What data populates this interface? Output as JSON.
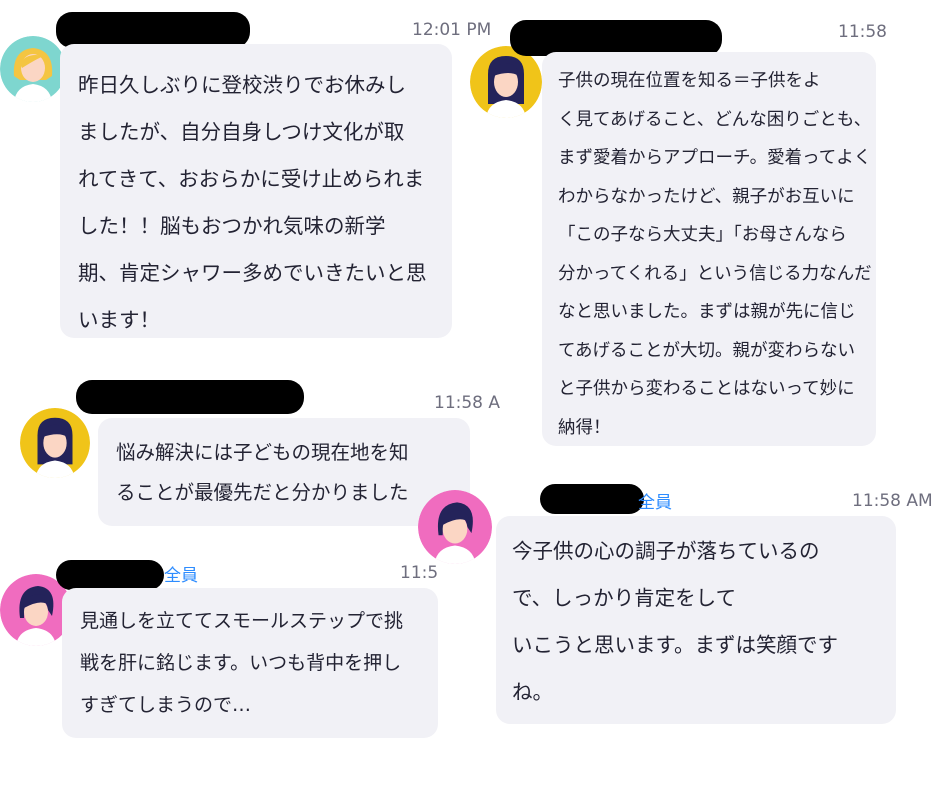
{
  "messages": [
    {
      "id": "m1",
      "time": "12:01 PM",
      "avatar": "blonde-woman-avatar",
      "avatar_bg": "#7ed6cf",
      "lines": [
        "昨日久しぶりに登校渋りでお休みし",
        "ましたが、自分自身しつけ文化が取",
        "れてきて、おおらかに受け止められま",
        "した！！脳もおつかれ気味の新学",
        "期、肯定シャワー多めでいきたいと思",
        "います！"
      ]
    },
    {
      "id": "m2",
      "time": "11:58",
      "avatar": "dark-hair-woman-avatar",
      "avatar_bg": "#f0c419",
      "lines": [
        "子供の現在位置を知る＝子供をよ",
        "く見てあげること、どんな困りごとも、",
        "まず愛着からアプローチ。愛着ってよく",
        "わからなかったけど、親子がお互いに",
        "「この子なら大丈夫」「お母さんなら",
        "分かってくれる」という信じる力なんだ",
        "なと思いました。まずは親が先に信じ",
        "てあげることが大切。親が変わらない",
        "と子供から変わることはないって妙に",
        "納得！"
      ]
    },
    {
      "id": "m3",
      "time": "11:58 A",
      "avatar": "dark-hair-woman-avatar",
      "avatar_bg": "#f0c419",
      "lines": [
        "悩み解決には子どもの現在地を知",
        "ることが最優先だと分かりました"
      ]
    },
    {
      "id": "m4",
      "time": "11:58 AM",
      "to": "全員",
      "avatar": "short-hair-woman-avatar",
      "avatar_bg": "#f06cbf",
      "lines": [
        "今子供の心の調子が落ちているの",
        "で、しっかり肯定をして",
        "いこうと思います。まずは笑顔です",
        "ね。"
      ]
    },
    {
      "id": "m5",
      "time": "11:5",
      "to": "全員",
      "avatar": "short-hair-woman-avatar",
      "avatar_bg": "#f06cbf",
      "lines": [
        "見通しを立ててスモールステップで挑",
        "戦を肝に銘じます。いつも背中を押し",
        "すぎてしまうので…"
      ]
    }
  ],
  "colors": {
    "bubble": "#f1f1f6",
    "timestamp": "#6e6e7e",
    "recipient": "#2d8cff",
    "redaction": "#000000"
  }
}
